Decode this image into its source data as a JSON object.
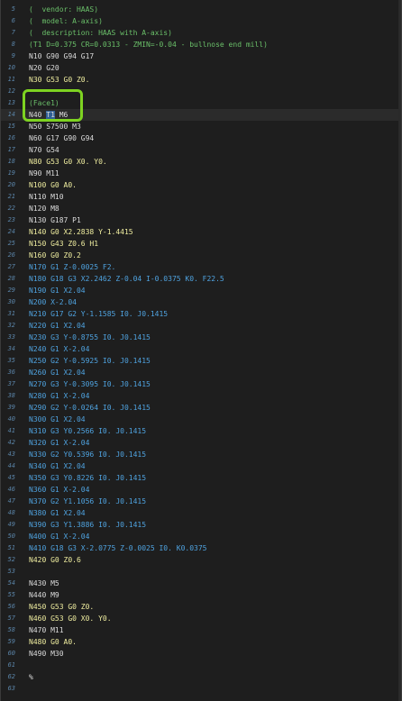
{
  "editor": {
    "lines": [
      {
        "num": "5",
        "tokens": [
          {
            "text": "(  vendor: HAAS)",
            "style": "comment"
          }
        ]
      },
      {
        "num": "6",
        "tokens": [
          {
            "text": "(  model: A-axis)",
            "style": "comment"
          }
        ]
      },
      {
        "num": "7",
        "tokens": [
          {
            "text": "(  description: HAAS with A-axis)",
            "style": "comment"
          }
        ]
      },
      {
        "num": "8",
        "tokens": [
          {
            "text": "(T1 D=0.375 CR=0.0313 - ZMIN=-0.04 - bullnose end mill)",
            "style": "comment"
          }
        ]
      },
      {
        "num": "9",
        "tokens": [
          {
            "text": "N10 G90 G94 G17",
            "style": "white"
          }
        ]
      },
      {
        "num": "10",
        "tokens": [
          {
            "text": "N20 G20",
            "style": "white"
          }
        ]
      },
      {
        "num": "11",
        "tokens": [
          {
            "text": "N30 G53 G0 Z0.",
            "style": "yellow"
          }
        ]
      },
      {
        "num": "12",
        "tokens": []
      },
      {
        "num": "13",
        "tokens": [
          {
            "text": "(Face1)",
            "style": "comment"
          }
        ]
      },
      {
        "num": "14",
        "current": true,
        "tokens": [
          {
            "text": "N40 ",
            "style": "white"
          },
          {
            "text": "T1",
            "style": "sel"
          },
          {
            "text": " M6",
            "style": "white"
          }
        ]
      },
      {
        "num": "15",
        "tokens": [
          {
            "text": "N50 S7500 M3",
            "style": "white"
          }
        ]
      },
      {
        "num": "16",
        "tokens": [
          {
            "text": "N60 G17 G90 G94",
            "style": "white"
          }
        ]
      },
      {
        "num": "17",
        "tokens": [
          {
            "text": "N70 G54",
            "style": "white"
          }
        ]
      },
      {
        "num": "18",
        "tokens": [
          {
            "text": "N80 G53 G0 X0. Y0.",
            "style": "yellow"
          }
        ]
      },
      {
        "num": "19",
        "tokens": [
          {
            "text": "N90 M11",
            "style": "white"
          }
        ]
      },
      {
        "num": "20",
        "tokens": [
          {
            "text": "N100 G0 A0.",
            "style": "yellow"
          }
        ]
      },
      {
        "num": "21",
        "tokens": [
          {
            "text": "N110 M10",
            "style": "white"
          }
        ]
      },
      {
        "num": "22",
        "tokens": [
          {
            "text": "N120 M8",
            "style": "white"
          }
        ]
      },
      {
        "num": "23",
        "tokens": [
          {
            "text": "N130 G187 P1",
            "style": "white"
          }
        ]
      },
      {
        "num": "24",
        "tokens": [
          {
            "text": "N140 G0 X2.2838 Y-1.4415",
            "style": "yellow"
          }
        ]
      },
      {
        "num": "25",
        "tokens": [
          {
            "text": "N150 G43 Z0.6 H1",
            "style": "yellow"
          }
        ]
      },
      {
        "num": "26",
        "tokens": [
          {
            "text": "N160 G0 Z0.2",
            "style": "yellow"
          }
        ]
      },
      {
        "num": "27",
        "tokens": [
          {
            "text": "N170 G1 Z-0.0025 F2.",
            "style": "blue"
          }
        ]
      },
      {
        "num": "28",
        "tokens": [
          {
            "text": "N180 G18 G3 X2.2462 Z-0.04 I-0.0375 K0. F22.5",
            "style": "blue"
          }
        ]
      },
      {
        "num": "29",
        "tokens": [
          {
            "text": "N190 G1 X2.04",
            "style": "blue"
          }
        ]
      },
      {
        "num": "30",
        "tokens": [
          {
            "text": "N200 X-2.04",
            "style": "blue"
          }
        ]
      },
      {
        "num": "31",
        "tokens": [
          {
            "text": "N210 G17 G2 Y-1.1585 I0. J0.1415",
            "style": "blue"
          }
        ]
      },
      {
        "num": "32",
        "tokens": [
          {
            "text": "N220 G1 X2.04",
            "style": "blue"
          }
        ]
      },
      {
        "num": "33",
        "tokens": [
          {
            "text": "N230 G3 Y-0.8755 I0. J0.1415",
            "style": "blue"
          }
        ]
      },
      {
        "num": "34",
        "tokens": [
          {
            "text": "N240 G1 X-2.04",
            "style": "blue"
          }
        ]
      },
      {
        "num": "35",
        "tokens": [
          {
            "text": "N250 G2 Y-0.5925 I0. J0.1415",
            "style": "blue"
          }
        ]
      },
      {
        "num": "36",
        "tokens": [
          {
            "text": "N260 G1 X2.04",
            "style": "blue"
          }
        ]
      },
      {
        "num": "37",
        "tokens": [
          {
            "text": "N270 G3 Y-0.3095 I0. J0.1415",
            "style": "blue"
          }
        ]
      },
      {
        "num": "38",
        "tokens": [
          {
            "text": "N280 G1 X-2.04",
            "style": "blue"
          }
        ]
      },
      {
        "num": "39",
        "tokens": [
          {
            "text": "N290 G2 Y-0.0264 I0. J0.1415",
            "style": "blue"
          }
        ]
      },
      {
        "num": "40",
        "tokens": [
          {
            "text": "N300 G1 X2.04",
            "style": "blue"
          }
        ]
      },
      {
        "num": "41",
        "tokens": [
          {
            "text": "N310 G3 Y0.2566 I0. J0.1415",
            "style": "blue"
          }
        ]
      },
      {
        "num": "42",
        "tokens": [
          {
            "text": "N320 G1 X-2.04",
            "style": "blue"
          }
        ]
      },
      {
        "num": "43",
        "tokens": [
          {
            "text": "N330 G2 Y0.5396 I0. J0.1415",
            "style": "blue"
          }
        ]
      },
      {
        "num": "44",
        "tokens": [
          {
            "text": "N340 G1 X2.04",
            "style": "blue"
          }
        ]
      },
      {
        "num": "45",
        "tokens": [
          {
            "text": "N350 G3 Y0.8226 I0. J0.1415",
            "style": "blue"
          }
        ]
      },
      {
        "num": "46",
        "tokens": [
          {
            "text": "N360 G1 X-2.04",
            "style": "blue"
          }
        ]
      },
      {
        "num": "47",
        "tokens": [
          {
            "text": "N370 G2 Y1.1056 I0. J0.1415",
            "style": "blue"
          }
        ]
      },
      {
        "num": "48",
        "tokens": [
          {
            "text": "N380 G1 X2.04",
            "style": "blue"
          }
        ]
      },
      {
        "num": "49",
        "tokens": [
          {
            "text": "N390 G3 Y1.3886 I0. J0.1415",
            "style": "blue"
          }
        ]
      },
      {
        "num": "50",
        "tokens": [
          {
            "text": "N400 G1 X-2.04",
            "style": "blue"
          }
        ]
      },
      {
        "num": "51",
        "tokens": [
          {
            "text": "N410 G18 G3 X-2.0775 Z-0.0025 I0. K0.0375",
            "style": "blue"
          }
        ]
      },
      {
        "num": "52",
        "tokens": [
          {
            "text": "N420 G0 Z0.6",
            "style": "yellow"
          }
        ]
      },
      {
        "num": "53",
        "tokens": []
      },
      {
        "num": "54",
        "tokens": [
          {
            "text": "N430 M5",
            "style": "white"
          }
        ]
      },
      {
        "num": "55",
        "tokens": [
          {
            "text": "N440 M9",
            "style": "white"
          }
        ]
      },
      {
        "num": "56",
        "tokens": [
          {
            "text": "N450 G53 G0 Z0.",
            "style": "yellow"
          }
        ]
      },
      {
        "num": "57",
        "tokens": [
          {
            "text": "N460 G53 G0 X0. Y0.",
            "style": "yellow"
          }
        ]
      },
      {
        "num": "58",
        "tokens": [
          {
            "text": "N470 M11",
            "style": "white"
          }
        ]
      },
      {
        "num": "59",
        "tokens": [
          {
            "text": "N480 G0 A0.",
            "style": "yellow"
          }
        ]
      },
      {
        "num": "60",
        "tokens": [
          {
            "text": "N490 M30",
            "style": "white"
          }
        ]
      },
      {
        "num": "61",
        "tokens": []
      },
      {
        "num": "62",
        "tokens": [
          {
            "text": "%",
            "style": "white"
          }
        ]
      },
      {
        "num": "63",
        "tokens": []
      }
    ],
    "highlight_color": "#7ed321"
  }
}
